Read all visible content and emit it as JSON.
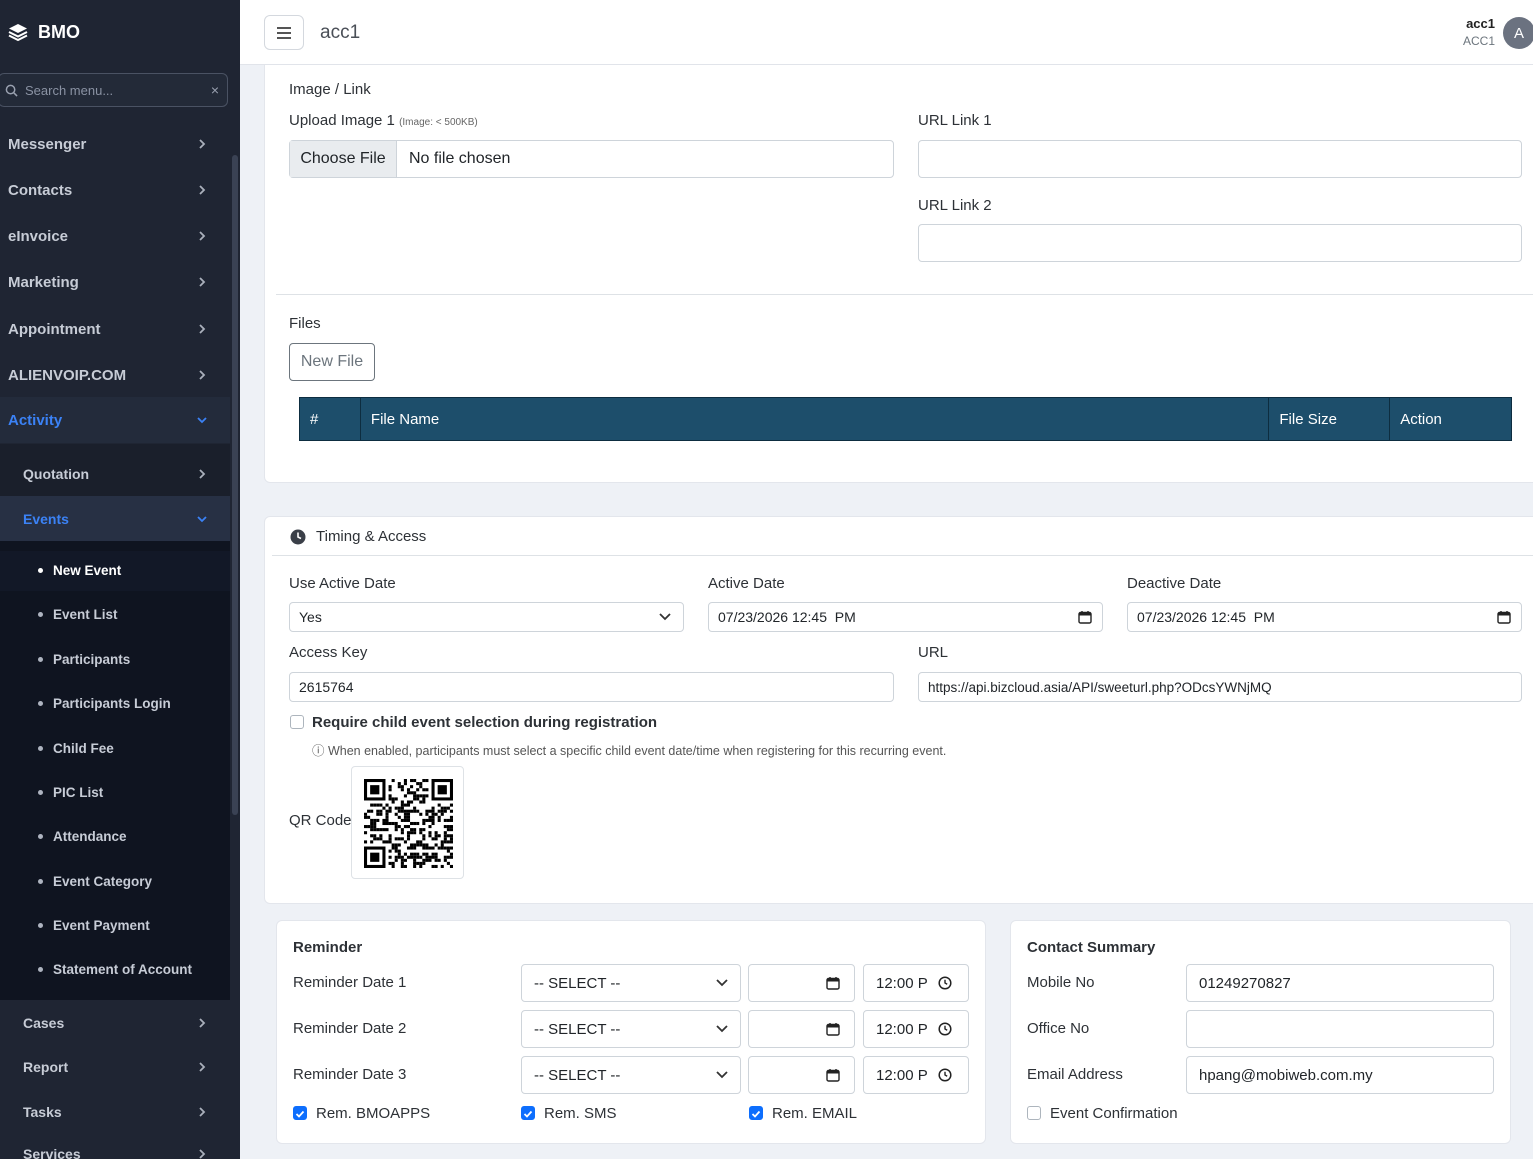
{
  "brand": "BMO",
  "sidebar": {
    "search_placeholder": "Search menu...",
    "items": [
      {
        "label": "Messenger"
      },
      {
        "label": "Contacts"
      },
      {
        "label": "eInvoice"
      },
      {
        "label": "Marketing"
      },
      {
        "label": "Appointment"
      },
      {
        "label": "ALIENVOIP.COM"
      },
      {
        "label": "Activity"
      }
    ],
    "activity_sub": [
      {
        "label": "Quotation"
      },
      {
        "label": "Events"
      }
    ],
    "events_sub": [
      {
        "label": "New Event"
      },
      {
        "label": "Event List"
      },
      {
        "label": "Participants"
      },
      {
        "label": "Participants Login"
      },
      {
        "label": "Child Fee"
      },
      {
        "label": "PIC List"
      },
      {
        "label": "Attendance"
      },
      {
        "label": "Event Category"
      },
      {
        "label": "Event Payment"
      },
      {
        "label": "Statement of Account"
      }
    ],
    "after": [
      {
        "label": "Cases"
      },
      {
        "label": "Report"
      },
      {
        "label": "Tasks"
      },
      {
        "label": "Services"
      }
    ]
  },
  "header": {
    "title": "acc1",
    "user_name": "acc1",
    "user_sub": "ACC1",
    "avatar": "A"
  },
  "image_link": {
    "section": "Image / Link",
    "upload_label": "Upload Image 1",
    "upload_hint": "(Image: < 500KB)",
    "choose_file": "Choose File",
    "no_file": "No file chosen",
    "url1_label": "URL Link 1",
    "url1_value": "",
    "url2_label": "URL Link 2",
    "url2_value": ""
  },
  "files": {
    "section": "Files",
    "new_file": "New File",
    "columns": [
      "#",
      "File Name",
      "File Size",
      "Action"
    ]
  },
  "timing": {
    "title": "Timing & Access",
    "use_active_label": "Use Active Date",
    "use_active_value": "Yes",
    "active_label": "Active Date",
    "active_value": "07/23/2026 12:45  PM",
    "deactive_label": "Deactive Date",
    "deactive_value": "07/23/2026 12:45  PM",
    "access_key_label": "Access Key",
    "access_key_value": "2615764",
    "url_label": "URL",
    "url_value": "https://api.bizcloud.asia/API/sweeturl.php?ODcsYWNjMQ",
    "require_label": "Require child event selection during registration",
    "require_hint": "ⓘ When enabled, participants must select a specific child event date/time when registering for this recurring event.",
    "qr_label": "QR Code"
  },
  "reminder": {
    "title": "Reminder",
    "rows": [
      {
        "label": "Reminder Date 1",
        "select": "-- SELECT --",
        "date": "",
        "time": "12:00 P"
      },
      {
        "label": "Reminder Date 2",
        "select": "-- SELECT --",
        "date": "",
        "time": "12:00 P"
      },
      {
        "label": "Reminder Date 3",
        "select": "-- SELECT --",
        "date": "",
        "time": "12:00 P"
      }
    ],
    "checks": [
      {
        "label": "Rem. BMOAPPS",
        "checked": true
      },
      {
        "label": "Rem. SMS",
        "checked": true
      },
      {
        "label": "Rem. EMAIL",
        "checked": true
      }
    ]
  },
  "contact": {
    "title": "Contact Summary",
    "mobile_label": "Mobile No",
    "mobile_value": "01249270827",
    "office_label": "Office No",
    "office_value": "",
    "email_label": "Email Address",
    "email_value": "hpang@mobiweb.com.my",
    "confirm_label": "Event Confirmation",
    "confirm_checked": false
  },
  "colors": {
    "sidebar_bg": "#1f2533",
    "accent": "#3b82f6",
    "table_header": "#1d4e6b",
    "checkbox": "#0d6efd"
  }
}
